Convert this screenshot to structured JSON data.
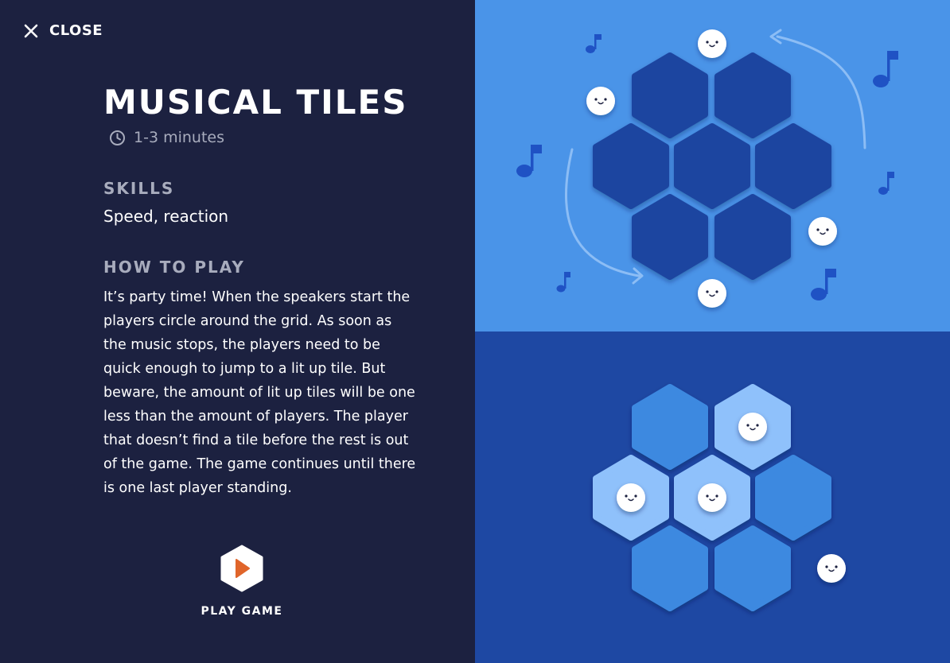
{
  "close": {
    "label": "CLOSE",
    "icon": "close-icon"
  },
  "game": {
    "title": "MUSICAL TILES",
    "duration": "1-3 minutes",
    "skills_heading": "SKILLS",
    "skills": "Speed, reaction",
    "how_heading": "HOW TO PLAY",
    "how_text": "It’s party time! When the speakers start the players circle around the grid. As soon as the music stops, the players need to be quick enough to jump to a lit up tile. But beware, the amount of lit up tiles will be one less than the amount of players. The player that doesn’t find a tile before the rest is out of the game. The game continues until there is one last player standing."
  },
  "play": {
    "label": "PLAY GAME",
    "icon": "play-icon"
  },
  "colors": {
    "panel": "#1c2140",
    "top_bg": "#4a94e8",
    "bottom_bg": "#1e48a3",
    "tile_dark": "#1e45a0",
    "tile_mid": "#3d89e0",
    "tile_lit": "#8fc1fb",
    "note": "#1f52c4",
    "play_accent": "#e0652a"
  }
}
